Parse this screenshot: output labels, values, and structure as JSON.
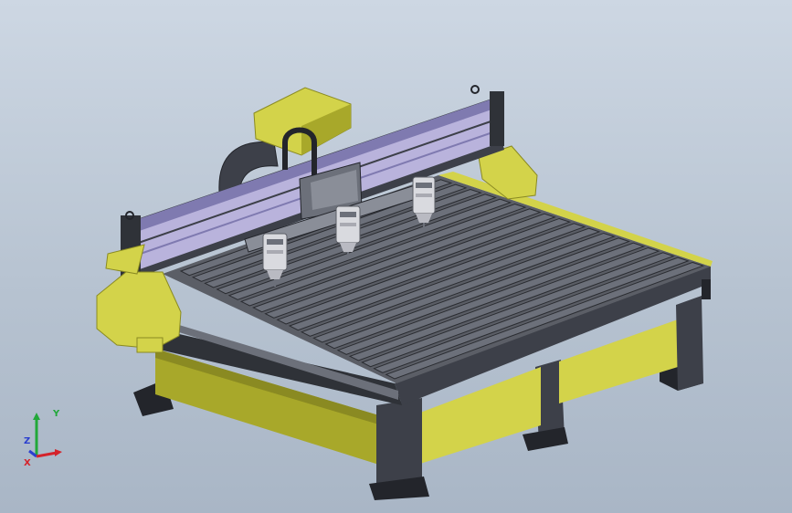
{
  "viewport": {
    "background_top": "#cdd7e3",
    "background_bottom": "#a9b6c6"
  },
  "model": {
    "colors": {
      "yellow": "#d3d34a",
      "yellow_dark": "#a8a82a",
      "steel": "#3d4049",
      "steel_dark": "#23252b",
      "table_top": "#5b5e66",
      "slat": "#6c707a",
      "slat_gap": "#2a2c31",
      "beam": "#b9b3dc",
      "beam_dark": "#7f7ab0",
      "spindle": "#d9dadf"
    },
    "spindle_count": 3
  },
  "triad": {
    "y_label": "Y",
    "z_label": "Z",
    "x_label": "X",
    "y_color": "#22a83a",
    "z_color": "#2b3fcf",
    "x_color": "#d4232b"
  }
}
